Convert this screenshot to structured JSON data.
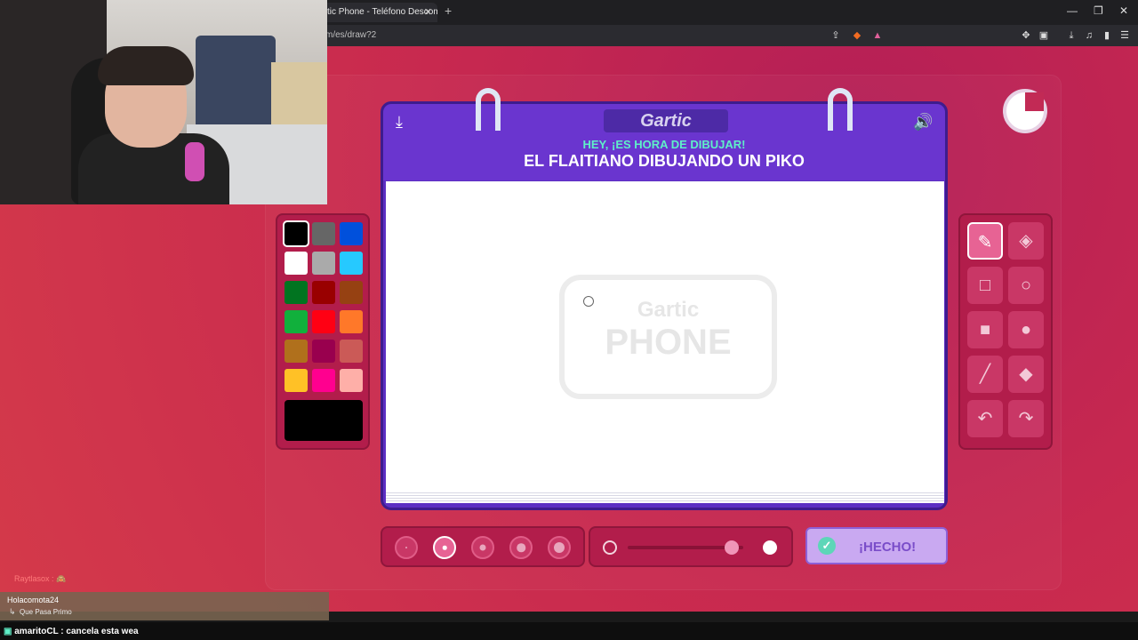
{
  "browser": {
    "tab_title": "tic Phone - Teléfono Descom",
    "tab_close": "✕",
    "new_tab": "+",
    "url": "m/es/draw?2",
    "window_controls": [
      "—",
      "❐",
      "✕"
    ]
  },
  "board": {
    "logo": "Gartic",
    "hint": "HEY, ¡ES HORA DE DIBUJAR!",
    "prompt": "EL FLAITIANO DIBUJANDO UN PIKO",
    "download_icon": "download-icon",
    "volume_icon": "volume-icon",
    "watermark_top": "Gartic",
    "watermark_bottom": "PHONE"
  },
  "palette": {
    "colors": [
      "#000000",
      "#666666",
      "#0050dc",
      "#ffffff",
      "#aaaaaa",
      "#26c9ff",
      "#017420",
      "#990000",
      "#964112",
      "#11b03c",
      "#ff0013",
      "#ff7829",
      "#b0701c",
      "#99004e",
      "#cb5a57",
      "#ffc126",
      "#ff008f",
      "#feafa8"
    ],
    "selected_index": 0,
    "current_color": "#000000"
  },
  "tools": [
    {
      "name": "pencil",
      "icon": "✎",
      "selected": true
    },
    {
      "name": "eraser",
      "icon": "◈",
      "selected": false
    },
    {
      "name": "rect-outline",
      "icon": "□",
      "selected": false
    },
    {
      "name": "ellipse-outline",
      "icon": "○",
      "selected": false
    },
    {
      "name": "rect-fill",
      "icon": "■",
      "selected": false
    },
    {
      "name": "ellipse-fill",
      "icon": "●",
      "selected": false
    },
    {
      "name": "line",
      "icon": "╱",
      "selected": false
    },
    {
      "name": "fill-bucket",
      "icon": "◆",
      "selected": false
    },
    {
      "name": "undo",
      "icon": "↶",
      "selected": false
    },
    {
      "name": "redo",
      "icon": "↷",
      "selected": false
    }
  ],
  "brush_sizes": {
    "count": 5,
    "selected_index": 1
  },
  "opacity": {
    "level": 0.9
  },
  "done_button": {
    "label": "¡HECHO!",
    "icon": "✓"
  },
  "chat": {
    "line1": "Raytlasox : 🙈",
    "name": "Holacomota24",
    "sub": "Que Pasa Primo",
    "bottom_user": "amaritoCL",
    "bottom_message": ": cancela esta wea"
  }
}
